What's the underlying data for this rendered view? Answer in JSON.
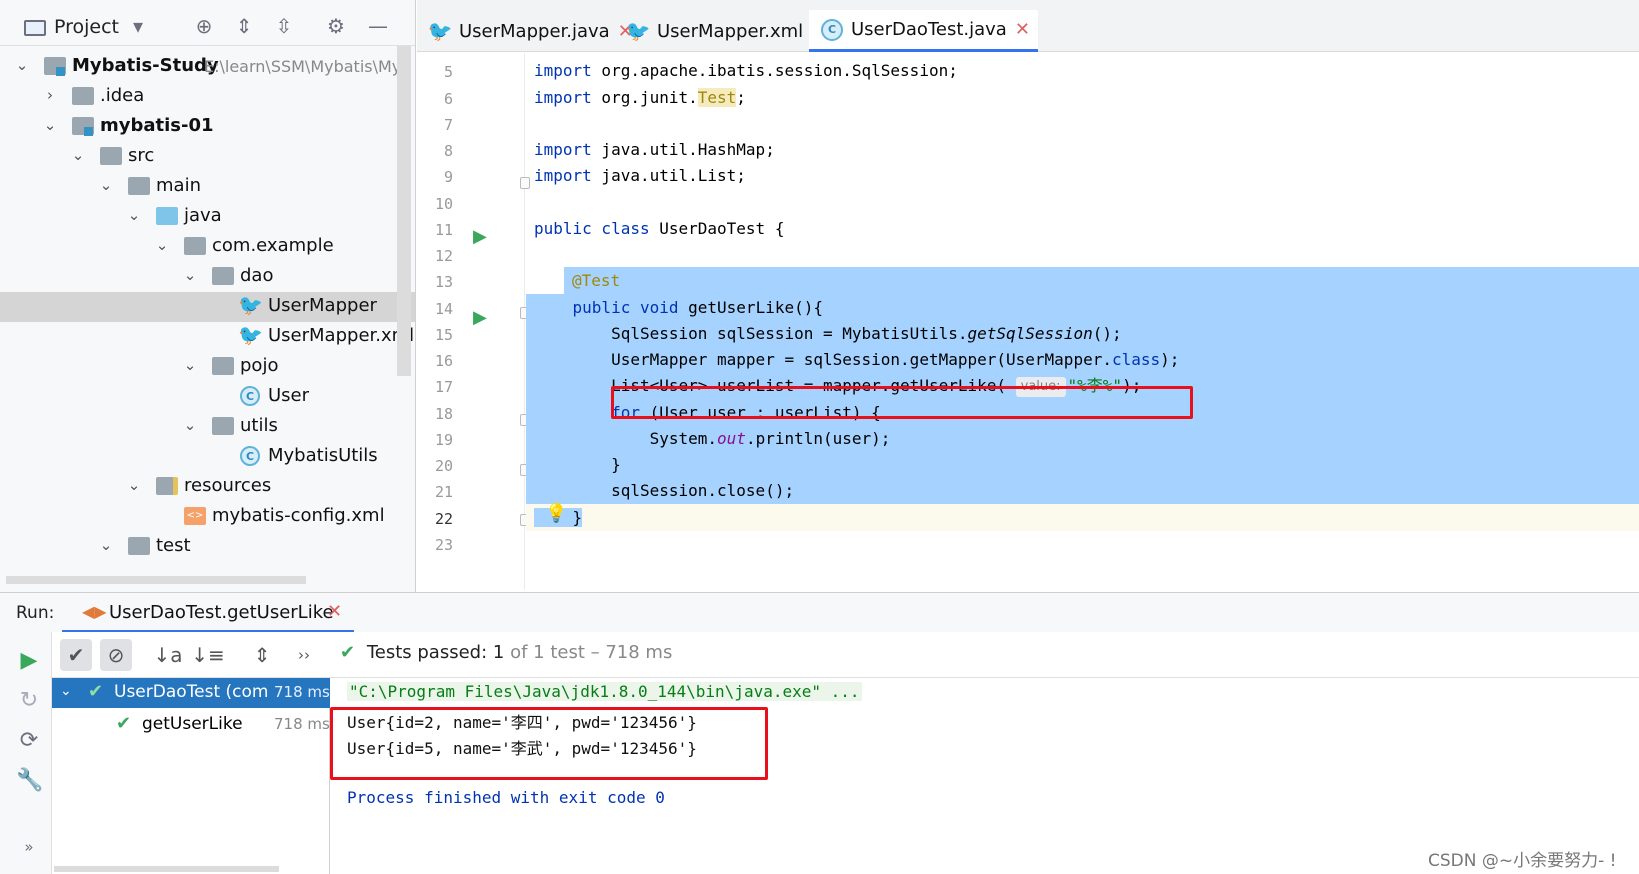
{
  "project_panel": {
    "title": "Project",
    "toolbar_icons": [
      "dropdown-icon",
      "locate-icon",
      "expand-all-icon",
      "collapse-all-icon",
      "gear-icon",
      "minimize-icon"
    ],
    "tree": [
      {
        "label": "Mybatis-Study",
        "path": "E:\\learn\\SSM\\Mybatis\\My",
        "type": "module",
        "expanded": true
      },
      {
        "label": ".idea",
        "type": "folder",
        "expanded": false
      },
      {
        "label": "mybatis-01",
        "type": "module",
        "expanded": true
      },
      {
        "label": "src",
        "type": "folder",
        "expanded": true
      },
      {
        "label": "main",
        "type": "folder",
        "expanded": true
      },
      {
        "label": "java",
        "type": "source-folder",
        "expanded": true
      },
      {
        "label": "com.example",
        "type": "package",
        "expanded": true
      },
      {
        "label": "dao",
        "type": "package",
        "expanded": true
      },
      {
        "label": "UserMapper",
        "type": "mybatis-interface",
        "selected": true
      },
      {
        "label": "UserMapper.xml",
        "type": "mybatis-xml"
      },
      {
        "label": "pojo",
        "type": "package",
        "expanded": true
      },
      {
        "label": "User",
        "type": "class"
      },
      {
        "label": "utils",
        "type": "package",
        "expanded": true
      },
      {
        "label": "MybatisUtils",
        "type": "class"
      },
      {
        "label": "resources",
        "type": "resources-folder",
        "expanded": true
      },
      {
        "label": "mybatis-config.xml",
        "type": "xml-file"
      },
      {
        "label": "test",
        "type": "folder",
        "expanded": true
      }
    ]
  },
  "editor": {
    "tabs": [
      {
        "label": "UserMapper.java",
        "icon": "mybatis-bird-icon",
        "active": false
      },
      {
        "label": "UserMapper.xml",
        "icon": "mybatis-bird-icon",
        "active": false
      },
      {
        "label": "UserDaoTest.java",
        "icon": "class-icon",
        "active": true
      }
    ],
    "line_numbers": [
      "5",
      "6",
      "7",
      "8",
      "9",
      "10",
      "11",
      "12",
      "13",
      "14",
      "15",
      "16",
      "17",
      "18",
      "19",
      "20",
      "21",
      "22",
      "23"
    ],
    "current_line": "22",
    "param_hint": "value:"
  },
  "run": {
    "label": "Run:",
    "tab_label": "UserDaoTest.getUserLike",
    "status": {
      "prefix": "Tests passed:",
      "count": "1",
      "suffix": "of 1 test – 718 ms"
    },
    "tests": [
      {
        "name": "UserDaoTest (com",
        "time": "718 ms",
        "selected": true
      },
      {
        "name": "getUserLike",
        "time": "718 ms",
        "selected": false
      }
    ],
    "console": {
      "command": "\"C:\\Program Files\\Java\\jdk1.8.0_144\\bin\\java.exe\" ...",
      "lines": [
        "User{id=2, name='李四', pwd='123456'}",
        "User{id=5, name='李武', pwd='123456'}"
      ],
      "exit": "Process finished with exit code 0"
    }
  },
  "watermark": "CSDN @~小余要努力- !",
  "colors": {
    "selection": "#a6d2ff",
    "highlight_box": "#e8101b",
    "accent": "#3574f0",
    "pass": "#3aa85a"
  }
}
